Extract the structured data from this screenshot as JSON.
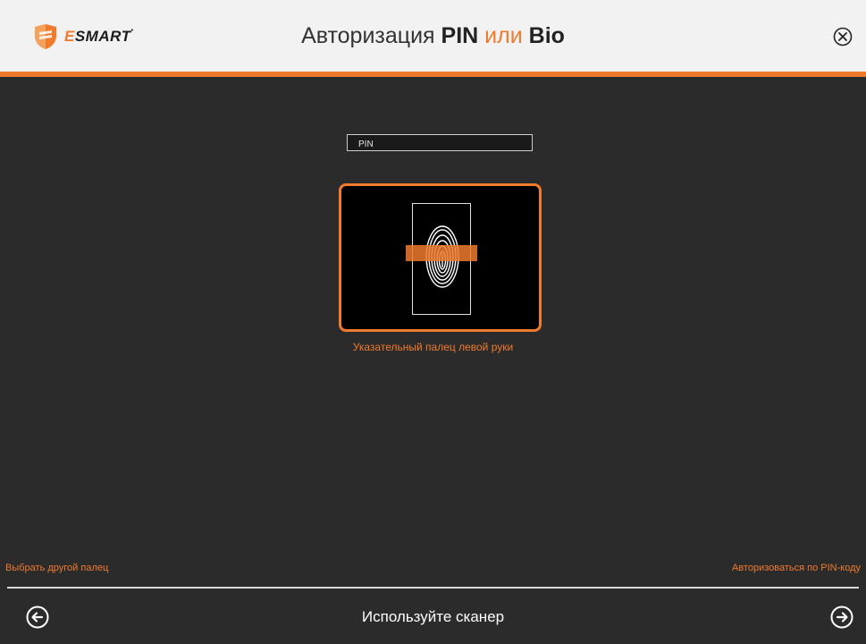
{
  "header": {
    "logo_text_main": "SMART",
    "logo_text_e": "E",
    "title_prefix": "Авторизация ",
    "title_pin": "PIN",
    "title_or": " или ",
    "title_bio": "Bio",
    "close_icon": "close-circle-icon"
  },
  "pin": {
    "placeholder": "PIN"
  },
  "scanner": {
    "caption": "Указательный палец левой руки",
    "icon": "fingerprint-icon"
  },
  "links": {
    "choose_finger": "Выбрать другой палец",
    "auth_by_pin": "Авторизоваться по PIN-коду"
  },
  "footer": {
    "status_text": "Используйте сканер",
    "back_icon": "arrow-left-circle-icon",
    "forward_icon": "arrow-right-circle-icon"
  },
  "colors": {
    "accent": "#f07a2e",
    "background": "#2b2b2b",
    "header_bg": "#f2f2f2"
  }
}
